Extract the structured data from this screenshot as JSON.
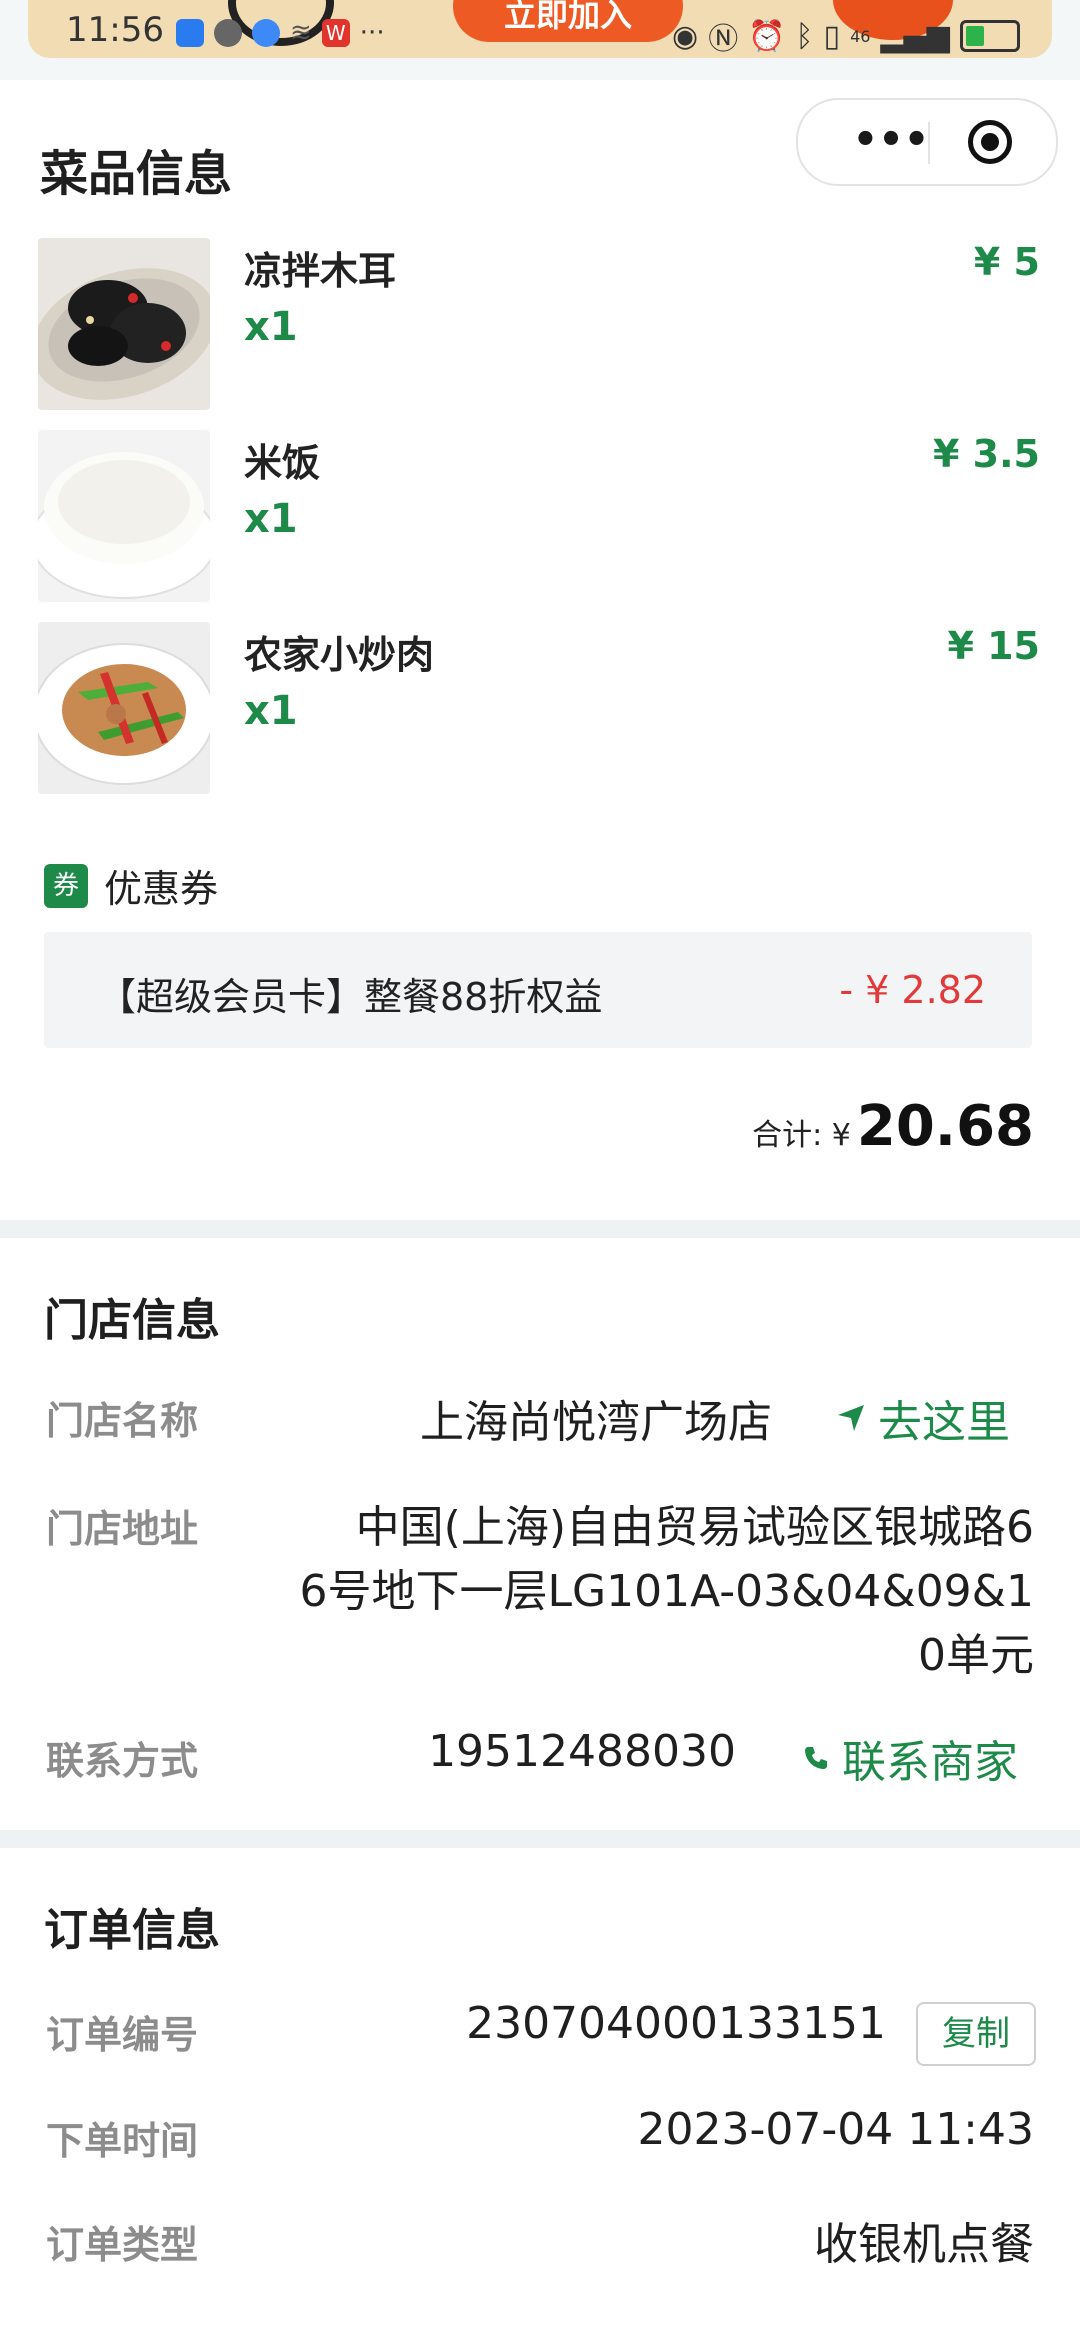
{
  "status_bar": {
    "time": "11:56",
    "banner_button": "立即加入",
    "more": "···",
    "network": "46"
  },
  "capsule": {
    "more_label": "•••"
  },
  "dishes_section": {
    "title": "菜品信息",
    "items": [
      {
        "name": "凉拌木耳",
        "qty": "x1",
        "price": "¥ 5"
      },
      {
        "name": "米饭",
        "qty": "x1",
        "price": "¥ 3.5"
      },
      {
        "name": "农家小炒肉",
        "qty": "x1",
        "price": "¥ 15"
      }
    ]
  },
  "coupon": {
    "icon_text": "券",
    "label": "优惠券",
    "description": "【超级会员卡】整餐88折权益",
    "amount": "- ¥ 2.82"
  },
  "total": {
    "label": "合计: ¥",
    "value": "20.68"
  },
  "store_section": {
    "title": "门店信息",
    "name_label": "门店名称",
    "name_value": "上海尚悦湾广场店",
    "navigate_label": "去这里",
    "address_label": "门店地址",
    "address_lines": [
      "中国(上海)自由贸易试验区银城路6",
      "6号地下一层LG101A-03&04&09&1",
      "0单元"
    ],
    "contact_label": "联系方式",
    "contact_value": "19512488030",
    "contact_link": "联系商家"
  },
  "order_section": {
    "title": "订单信息",
    "number_label": "订单编号",
    "number_value": "230704000133151",
    "copy_label": "复制",
    "time_label": "下单时间",
    "time_value": "2023-07-04 11:43",
    "type_label": "订单类型",
    "type_value": "收银机点餐"
  },
  "colors": {
    "accent_green": "#1d8a4a",
    "discount_red": "#e23a3a",
    "divider": "#eef2f3"
  }
}
